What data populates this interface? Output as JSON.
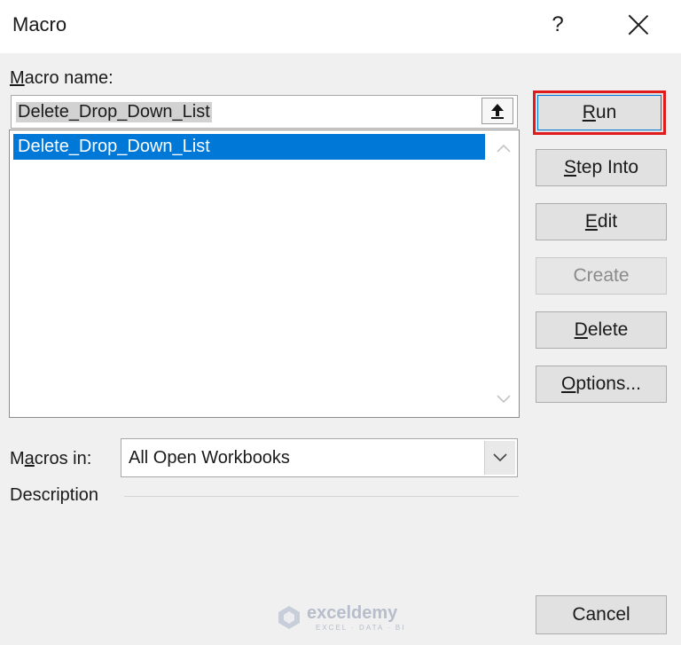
{
  "window": {
    "title": "Macro",
    "help_label": "?"
  },
  "macro_name": {
    "label_hotkey": "M",
    "label_rest": "acro name:",
    "value": "Delete_Drop_Down_List",
    "list_items": [
      "Delete_Drop_Down_List"
    ]
  },
  "buttons": {
    "run": {
      "hotkey": "R",
      "rest": "un"
    },
    "step_into": {
      "hotkey": "S",
      "rest": "tep Into"
    },
    "edit": {
      "hotkey": "E",
      "rest": "dit"
    },
    "create": {
      "label": "Create"
    },
    "delete": {
      "hotkey": "D",
      "rest": "elete"
    },
    "options": {
      "hotkey": "O",
      "rest": "ptions..."
    },
    "cancel": {
      "label": "Cancel"
    }
  },
  "macros_in": {
    "label_pre": "M",
    "label_hotkey": "a",
    "label_rest": "cros in:",
    "value": "All Open Workbooks"
  },
  "description": {
    "label": "Description"
  },
  "watermark": {
    "name": "exceldemy",
    "tagline": "EXCEL · DATA · BI"
  },
  "colors": {
    "selection": "#0078d7",
    "highlight_border": "#e01b1b",
    "dialog_bg": "#f0f0f0"
  },
  "icons": [
    "upload-arrow-icon",
    "chevron-up-icon",
    "chevron-down-icon",
    "close-icon",
    "help-icon"
  ]
}
